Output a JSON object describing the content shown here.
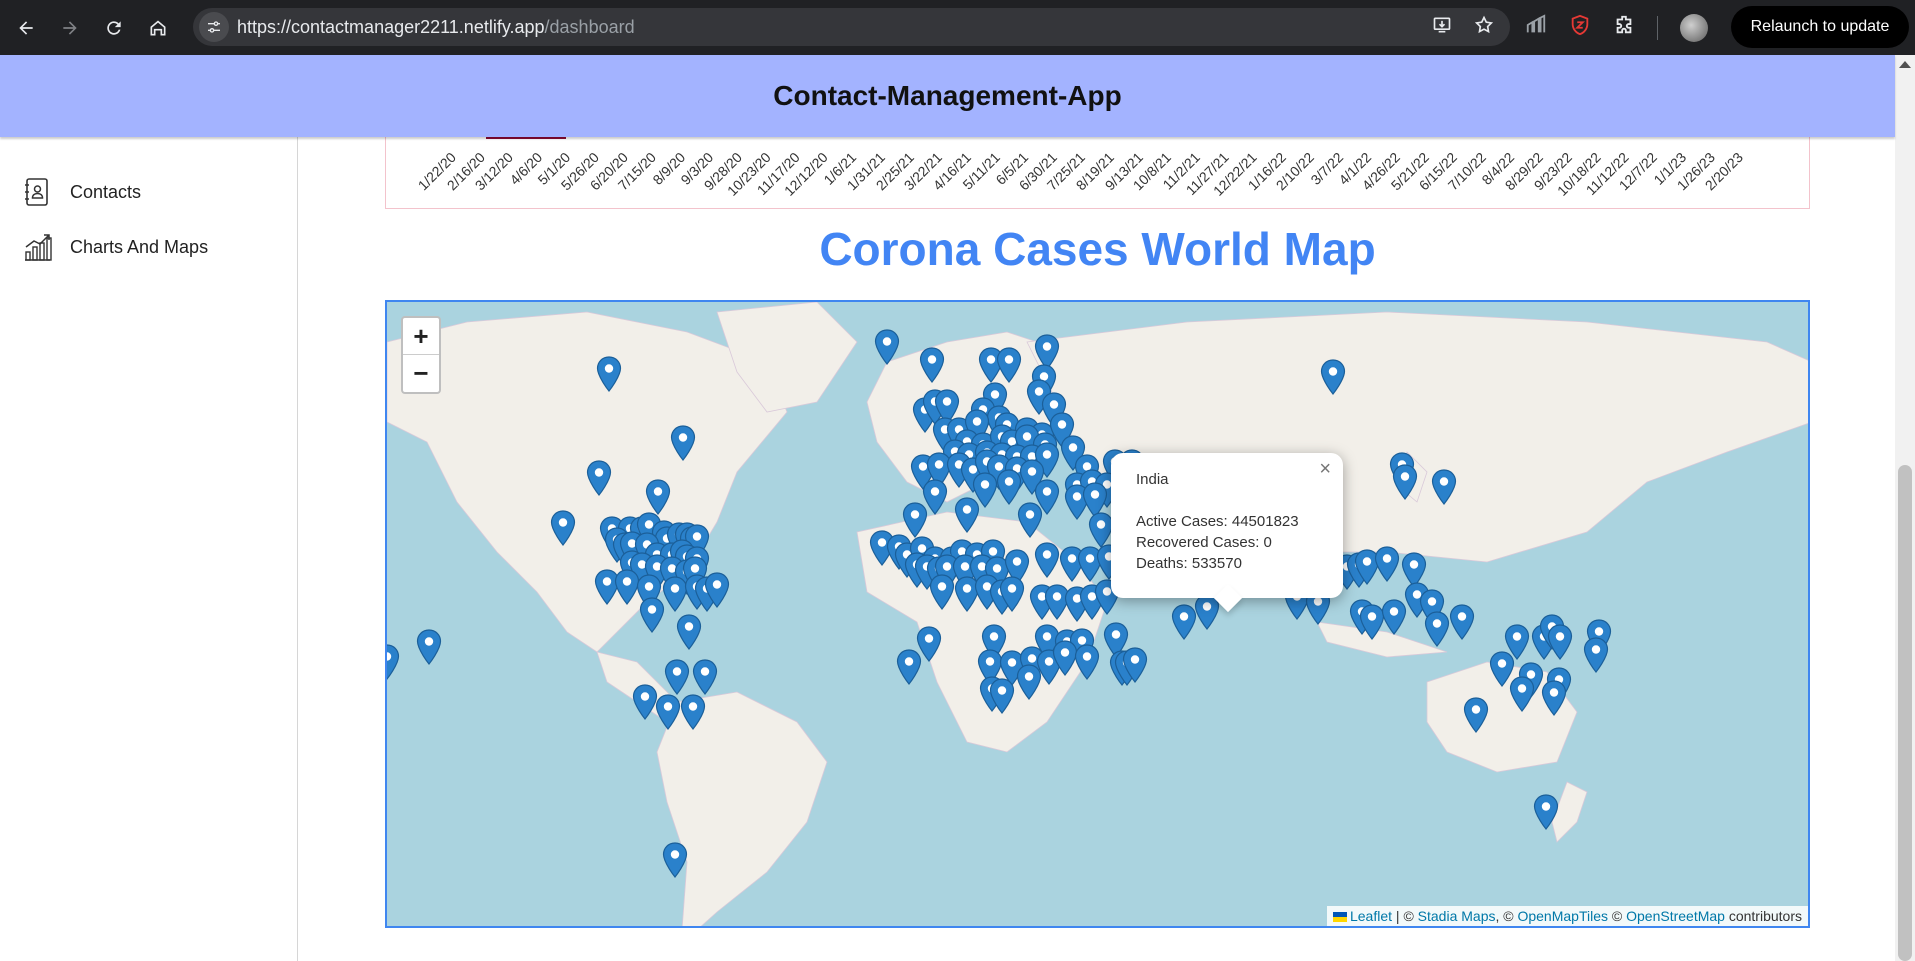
{
  "browser": {
    "url_host": "https://contactmanager2211.netlify.app",
    "url_path": "/dashboard",
    "relaunch_label": "Relaunch to update"
  },
  "header": {
    "title": "Contact-Management-App"
  },
  "sidebar": {
    "items": [
      {
        "label": "Contacts",
        "icon": "contacts-book-icon"
      },
      {
        "label": "Charts And Maps",
        "icon": "line-chart-icon"
      }
    ]
  },
  "chart": {
    "x_ticks": [
      "1/22/20",
      "2/16/20",
      "3/12/20",
      "4/6/20",
      "5/1/20",
      "5/26/20",
      "6/20/20",
      "7/15/20",
      "8/9/20",
      "9/3/20",
      "9/28/20",
      "10/23/20",
      "11/17/20",
      "12/12/20",
      "1/6/21",
      "1/31/21",
      "2/25/21",
      "3/22/21",
      "4/16/21",
      "5/11/21",
      "6/5/21",
      "6/30/21",
      "7/25/21",
      "8/19/21",
      "9/13/21",
      "10/8/21",
      "11/2/21",
      "11/27/21",
      "12/22/21",
      "1/16/22",
      "2/10/22",
      "3/7/22",
      "4/1/22",
      "4/26/22",
      "5/21/22",
      "6/15/22",
      "7/10/22",
      "8/4/22",
      "8/29/22",
      "9/23/22",
      "10/18/22",
      "11/12/22",
      "12/7/22",
      "1/1/23",
      "1/26/23",
      "2/20/23"
    ]
  },
  "map": {
    "title": "Corona Cases World Map",
    "zoom_in": "+",
    "zoom_out": "−",
    "popup": {
      "country": "India",
      "active": "Active Cases: 44501823",
      "recovered": "Recovered Cases: 0",
      "deaths": "Deaths: 533570",
      "close": "×"
    },
    "attribution": {
      "leaflet": "Leaflet",
      "sep1": " | © ",
      "stadia": "Stadia Maps",
      "sep2": ", © ",
      "omt": "OpenMapTiles",
      "sep3": " © ",
      "osm": "OpenStreetMap",
      "tail": " contributors"
    },
    "marker_color": "#2a81cb"
  }
}
